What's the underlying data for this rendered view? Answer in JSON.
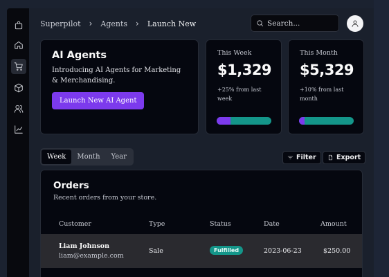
{
  "breadcrumb": [
    "Superpilot",
    "Agents",
    "Launch New"
  ],
  "search": {
    "placeholder": "Search..."
  },
  "ai_card": {
    "title": "AI Agents",
    "description": "Introducing AI Agents for Marketing & Merchandising.",
    "button": "Launch New AI Agent"
  },
  "stats": [
    {
      "label": "This Week",
      "value": "$1,329",
      "sub": "+25% from last week",
      "progress": 0.25
    },
    {
      "label": "This Month",
      "value": "$5,329",
      "sub": "+10% from last month",
      "progress": 0.1
    }
  ],
  "tabs": [
    "Week",
    "Month",
    "Year"
  ],
  "actions": {
    "filter": "Filter",
    "export": "Export"
  },
  "orders": {
    "title": "Orders",
    "description": "Recent orders from your store.",
    "columns": [
      "Customer",
      "Type",
      "Status",
      "Date",
      "Amount"
    ],
    "rows": [
      {
        "name": "Liam Johnson",
        "email": "liam@example.com",
        "type": "Sale",
        "status": "Fulfilled",
        "date": "2023-06-23",
        "amount": "$250.00"
      }
    ]
  },
  "colors": {
    "accent": "#7c3aed",
    "success": "#14968a",
    "background": "#1a202c",
    "card": "#05070f"
  },
  "icons": [
    "package-icon",
    "home-icon",
    "cart-icon",
    "box-icon",
    "users-icon",
    "chart-icon",
    "search-icon",
    "user-icon",
    "filter-icon",
    "file-icon",
    "chevron-right-icon"
  ]
}
